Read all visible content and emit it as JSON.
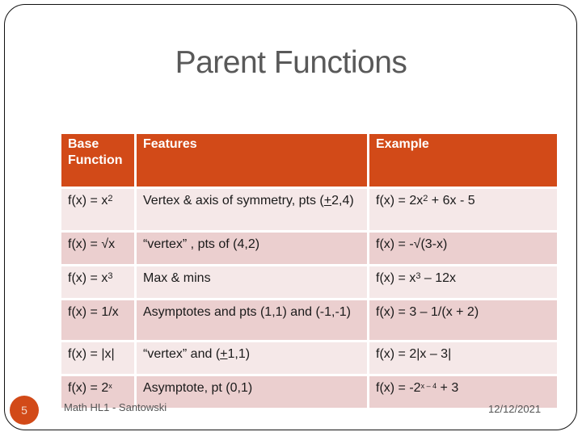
{
  "slide": {
    "title": "Parent Functions",
    "slide_number": "5",
    "footer_left": "Math HL1 - Santowski",
    "footer_right": "12/12/2021",
    "colors": {
      "accent": "#d24a18",
      "row_light": "#f5e8e8",
      "row_dark": "#ebcfcf",
      "title_text": "#595959"
    }
  },
  "table": {
    "headers": [
      "Base Function",
      "Features",
      "Example"
    ],
    "rows": [
      {
        "base_pre": "f(x) = x",
        "base_sup": "2",
        "base_post": "",
        "features_pre": "Vertex & axis of symmetry, pts (",
        "features_u": "+",
        "features_post": "2,4)",
        "example_pre": "f(x) = 2x",
        "example_sup": "2",
        "example_post": " + 6x - 5"
      },
      {
        "base_pre": "f(x) = √x",
        "base_sup": "",
        "base_post": "",
        "features_pre": "“vertex” , pts of (4,2)",
        "features_u": "",
        "features_post": "",
        "example_pre": "f(x) = -√(3-x)",
        "example_sup": "",
        "example_post": ""
      },
      {
        "base_pre": "f(x) = x",
        "base_sup": "3",
        "base_post": "",
        "features_pre": "Max & mins",
        "features_u": "",
        "features_post": "",
        "example_pre": "f(x) = x",
        "example_sup": "3",
        "example_post": " – 12x"
      },
      {
        "base_pre": "f(x) = 1/x",
        "base_sup": "",
        "base_post": "",
        "features_pre": "Asymptotes and pts (1,1) and (-1,-1)",
        "features_u": "",
        "features_post": "",
        "example_pre": "f(x) = 3 – 1/(x + 2)",
        "example_sup": "",
        "example_post": ""
      },
      {
        "base_pre": "f(x) = |x|",
        "base_sup": "",
        "base_post": "",
        "features_pre": "“vertex” and (",
        "features_u": "+",
        "features_post": "1,1)",
        "example_pre": "f(x) = 2|x – 3|",
        "example_sup": "",
        "example_post": ""
      },
      {
        "base_pre": "f(x) = 2",
        "base_sup": "x",
        "base_post": "",
        "features_pre": "Asymptote, pt (0,1)",
        "features_u": "",
        "features_post": "",
        "example_pre": "f(x) = -2",
        "example_sup": "x – 4",
        "example_post": " + 3"
      }
    ]
  }
}
